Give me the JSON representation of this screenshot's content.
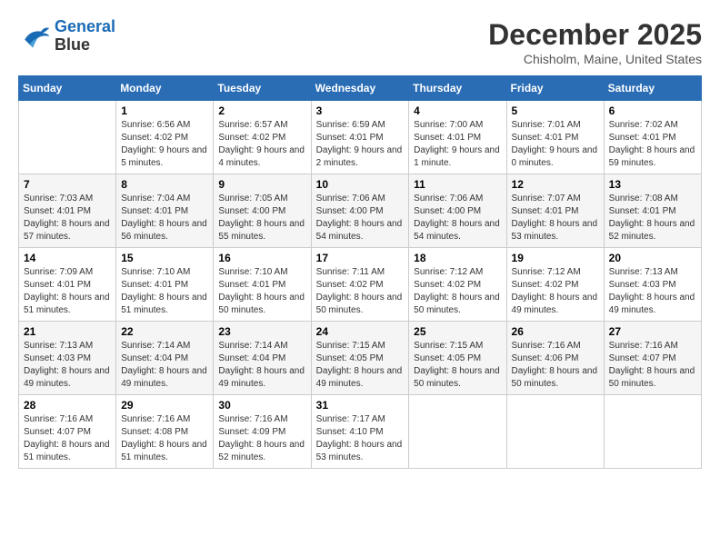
{
  "logo": {
    "line1": "General",
    "line2": "Blue"
  },
  "title": "December 2025",
  "location": "Chisholm, Maine, United States",
  "days_header": [
    "Sunday",
    "Monday",
    "Tuesday",
    "Wednesday",
    "Thursday",
    "Friday",
    "Saturday"
  ],
  "weeks": [
    [
      {
        "num": "",
        "sunrise": "",
        "sunset": "",
        "daylight": ""
      },
      {
        "num": "1",
        "sunrise": "Sunrise: 6:56 AM",
        "sunset": "Sunset: 4:02 PM",
        "daylight": "Daylight: 9 hours and 5 minutes."
      },
      {
        "num": "2",
        "sunrise": "Sunrise: 6:57 AM",
        "sunset": "Sunset: 4:02 PM",
        "daylight": "Daylight: 9 hours and 4 minutes."
      },
      {
        "num": "3",
        "sunrise": "Sunrise: 6:59 AM",
        "sunset": "Sunset: 4:01 PM",
        "daylight": "Daylight: 9 hours and 2 minutes."
      },
      {
        "num": "4",
        "sunrise": "Sunrise: 7:00 AM",
        "sunset": "Sunset: 4:01 PM",
        "daylight": "Daylight: 9 hours and 1 minute."
      },
      {
        "num": "5",
        "sunrise": "Sunrise: 7:01 AM",
        "sunset": "Sunset: 4:01 PM",
        "daylight": "Daylight: 9 hours and 0 minutes."
      },
      {
        "num": "6",
        "sunrise": "Sunrise: 7:02 AM",
        "sunset": "Sunset: 4:01 PM",
        "daylight": "Daylight: 8 hours and 59 minutes."
      }
    ],
    [
      {
        "num": "7",
        "sunrise": "Sunrise: 7:03 AM",
        "sunset": "Sunset: 4:01 PM",
        "daylight": "Daylight: 8 hours and 57 minutes."
      },
      {
        "num": "8",
        "sunrise": "Sunrise: 7:04 AM",
        "sunset": "Sunset: 4:01 PM",
        "daylight": "Daylight: 8 hours and 56 minutes."
      },
      {
        "num": "9",
        "sunrise": "Sunrise: 7:05 AM",
        "sunset": "Sunset: 4:00 PM",
        "daylight": "Daylight: 8 hours and 55 minutes."
      },
      {
        "num": "10",
        "sunrise": "Sunrise: 7:06 AM",
        "sunset": "Sunset: 4:00 PM",
        "daylight": "Daylight: 8 hours and 54 minutes."
      },
      {
        "num": "11",
        "sunrise": "Sunrise: 7:06 AM",
        "sunset": "Sunset: 4:00 PM",
        "daylight": "Daylight: 8 hours and 54 minutes."
      },
      {
        "num": "12",
        "sunrise": "Sunrise: 7:07 AM",
        "sunset": "Sunset: 4:01 PM",
        "daylight": "Daylight: 8 hours and 53 minutes."
      },
      {
        "num": "13",
        "sunrise": "Sunrise: 7:08 AM",
        "sunset": "Sunset: 4:01 PM",
        "daylight": "Daylight: 8 hours and 52 minutes."
      }
    ],
    [
      {
        "num": "14",
        "sunrise": "Sunrise: 7:09 AM",
        "sunset": "Sunset: 4:01 PM",
        "daylight": "Daylight: 8 hours and 51 minutes."
      },
      {
        "num": "15",
        "sunrise": "Sunrise: 7:10 AM",
        "sunset": "Sunset: 4:01 PM",
        "daylight": "Daylight: 8 hours and 51 minutes."
      },
      {
        "num": "16",
        "sunrise": "Sunrise: 7:10 AM",
        "sunset": "Sunset: 4:01 PM",
        "daylight": "Daylight: 8 hours and 50 minutes."
      },
      {
        "num": "17",
        "sunrise": "Sunrise: 7:11 AM",
        "sunset": "Sunset: 4:02 PM",
        "daylight": "Daylight: 8 hours and 50 minutes."
      },
      {
        "num": "18",
        "sunrise": "Sunrise: 7:12 AM",
        "sunset": "Sunset: 4:02 PM",
        "daylight": "Daylight: 8 hours and 50 minutes."
      },
      {
        "num": "19",
        "sunrise": "Sunrise: 7:12 AM",
        "sunset": "Sunset: 4:02 PM",
        "daylight": "Daylight: 8 hours and 49 minutes."
      },
      {
        "num": "20",
        "sunrise": "Sunrise: 7:13 AM",
        "sunset": "Sunset: 4:03 PM",
        "daylight": "Daylight: 8 hours and 49 minutes."
      }
    ],
    [
      {
        "num": "21",
        "sunrise": "Sunrise: 7:13 AM",
        "sunset": "Sunset: 4:03 PM",
        "daylight": "Daylight: 8 hours and 49 minutes."
      },
      {
        "num": "22",
        "sunrise": "Sunrise: 7:14 AM",
        "sunset": "Sunset: 4:04 PM",
        "daylight": "Daylight: 8 hours and 49 minutes."
      },
      {
        "num": "23",
        "sunrise": "Sunrise: 7:14 AM",
        "sunset": "Sunset: 4:04 PM",
        "daylight": "Daylight: 8 hours and 49 minutes."
      },
      {
        "num": "24",
        "sunrise": "Sunrise: 7:15 AM",
        "sunset": "Sunset: 4:05 PM",
        "daylight": "Daylight: 8 hours and 49 minutes."
      },
      {
        "num": "25",
        "sunrise": "Sunrise: 7:15 AM",
        "sunset": "Sunset: 4:05 PM",
        "daylight": "Daylight: 8 hours and 50 minutes."
      },
      {
        "num": "26",
        "sunrise": "Sunrise: 7:16 AM",
        "sunset": "Sunset: 4:06 PM",
        "daylight": "Daylight: 8 hours and 50 minutes."
      },
      {
        "num": "27",
        "sunrise": "Sunrise: 7:16 AM",
        "sunset": "Sunset: 4:07 PM",
        "daylight": "Daylight: 8 hours and 50 minutes."
      }
    ],
    [
      {
        "num": "28",
        "sunrise": "Sunrise: 7:16 AM",
        "sunset": "Sunset: 4:07 PM",
        "daylight": "Daylight: 8 hours and 51 minutes."
      },
      {
        "num": "29",
        "sunrise": "Sunrise: 7:16 AM",
        "sunset": "Sunset: 4:08 PM",
        "daylight": "Daylight: 8 hours and 51 minutes."
      },
      {
        "num": "30",
        "sunrise": "Sunrise: 7:16 AM",
        "sunset": "Sunset: 4:09 PM",
        "daylight": "Daylight: 8 hours and 52 minutes."
      },
      {
        "num": "31",
        "sunrise": "Sunrise: 7:17 AM",
        "sunset": "Sunset: 4:10 PM",
        "daylight": "Daylight: 8 hours and 53 minutes."
      },
      {
        "num": "",
        "sunrise": "",
        "sunset": "",
        "daylight": ""
      },
      {
        "num": "",
        "sunrise": "",
        "sunset": "",
        "daylight": ""
      },
      {
        "num": "",
        "sunrise": "",
        "sunset": "",
        "daylight": ""
      }
    ]
  ]
}
